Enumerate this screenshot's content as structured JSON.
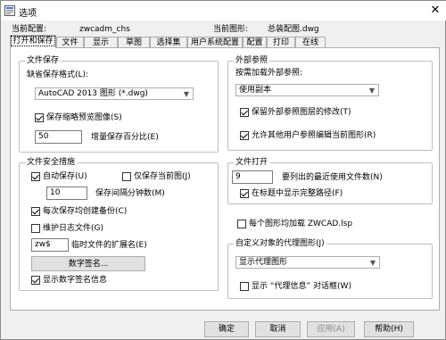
{
  "window": {
    "title": "选项",
    "close_glyph": "✕"
  },
  "header": {
    "config_label": "当前配置:",
    "config_value": "zwcadm_chs",
    "drawing_label": "当前图形:",
    "drawing_value": "总装配图.dwg"
  },
  "tabs": [
    {
      "label": "打开和保存",
      "active": true
    },
    {
      "label": "文件"
    },
    {
      "label": "显示"
    },
    {
      "label": "草图"
    },
    {
      "label": "选择集"
    },
    {
      "label": "用户系统配置"
    },
    {
      "label": "配置"
    },
    {
      "label": "打印"
    },
    {
      "label": "在线"
    }
  ],
  "file_save": {
    "title": "文件保存",
    "default_format_label": "缺省保存格式(L):",
    "format_value": "AutoCAD 2013 图形 (*.dwg)",
    "thumbnail_label": "保存缩略预览图像(S)",
    "thumbnail_checked": true,
    "incremental_value": "50",
    "incremental_label": "增量保存百分比(E)"
  },
  "file_safety": {
    "title": "文件安全措施",
    "autosave_label": "自动保存(U)",
    "autosave_checked": true,
    "save_current_only_label": "仅保存当前图(J)",
    "save_current_only_checked": false,
    "interval_value": "10",
    "interval_label": "保存间隔分钟数(M)",
    "backup_label": "每次保存均创建备份(C)",
    "backup_checked": true,
    "log_label": "维护日志文件(G)",
    "log_checked": false,
    "temp_ext_value": "zw$",
    "temp_ext_label": "临时文件的扩展名(E)",
    "digital_sign_button": "数字签名...",
    "show_sign_label": "显示数字签名信息",
    "show_sign_checked": true
  },
  "xref": {
    "title": "外部参照",
    "demand_load_label": "按需加载外部参照:",
    "demand_load_value": "使用副本",
    "retain_layer_label": "保留外部参照图层的修改(T)",
    "retain_layer_checked": true,
    "allow_edit_label": "允许其他用户参照编辑当前图形(R)",
    "allow_edit_checked": true
  },
  "file_open": {
    "title": "文件打开",
    "recent_count_value": "9",
    "recent_count_label": "要列出的最近使用文件数(N)",
    "show_path_label": "在标题中显示完整路径(F)",
    "show_path_checked": true
  },
  "lsp": {
    "label": "每个图形均加载 ZWCAD.lsp",
    "checked": false
  },
  "proxy": {
    "title": "自定义对象的代理图形(J)",
    "value": "显示代理图形",
    "show_dialog_label": "显示 “代理信息” 对话框(W)",
    "show_dialog_checked": false
  },
  "footer": {
    "ok": "确定",
    "cancel": "取消",
    "apply": "应用(A)",
    "help": "帮助(H)"
  }
}
